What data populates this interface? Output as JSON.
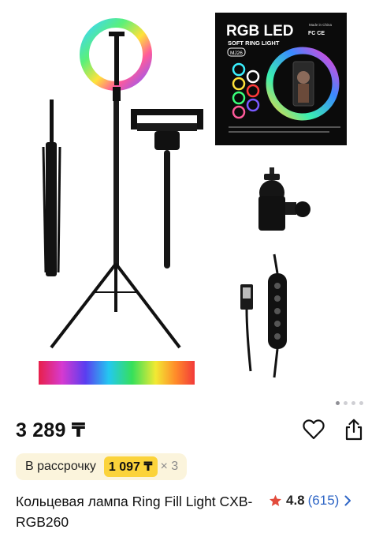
{
  "product": {
    "price": "3 289 ₸",
    "title": "Кольцевая лампа Ring Fill Light CXB-RGB260",
    "rating": "4.8",
    "reviews": "(615)"
  },
  "installment": {
    "label": "В рассрочку",
    "amount": "1 097 ₸",
    "multiplier": "× 3"
  },
  "package": {
    "brand": "RGB LED",
    "subtitle": "SOFT RING LIGHT",
    "model": "MJ26",
    "made_in": "Made in China"
  },
  "gallery": {
    "total_images": 4,
    "active_index": 0
  },
  "colors": {
    "rating_star": "#e24b3c",
    "link": "#2f66c6",
    "installment_bg": "#fbf4dc",
    "installment_badge": "#fbd33a"
  },
  "icons": [
    "heart-icon",
    "share-icon",
    "star-icon",
    "chevron-right-icon"
  ]
}
